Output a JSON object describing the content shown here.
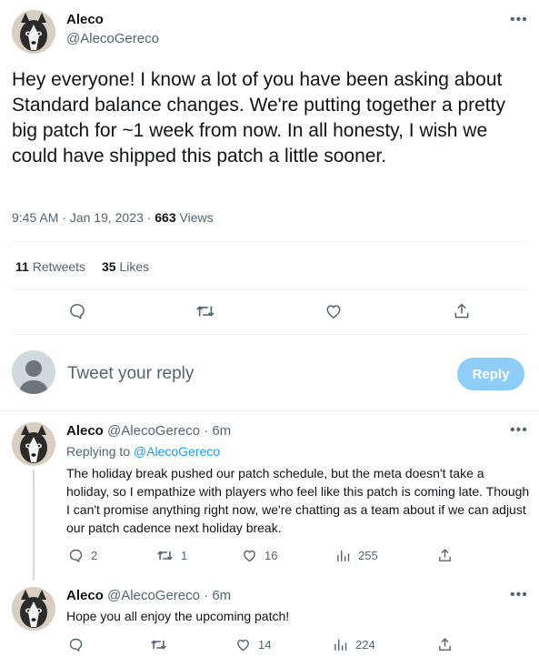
{
  "main_tweet": {
    "author_name": "Aleco",
    "author_handle": "@AlecoGereco",
    "text": "Hey everyone! I know a lot of you have been asking about Standard balance changes. We're putting together a pretty big patch for ~1 week from now. In all honesty, I wish we could have shipped this patch a little sooner.",
    "time": "9:45 AM",
    "date": "Jan 19, 2023",
    "views_count": "663",
    "views_label": "Views",
    "retweets_count": "11",
    "retweets_label": "Retweets",
    "likes_count": "35",
    "likes_label": "Likes"
  },
  "compose": {
    "placeholder": "Tweet your reply",
    "button_label": "Reply"
  },
  "replies": [
    {
      "author_name": "Aleco",
      "author_handle": "@AlecoGereco",
      "time": "6m",
      "replying_to_label": "Replying to",
      "replying_to_handle": "@AlecoGereco",
      "text": "The holiday break pushed our patch schedule, but the meta doesn't take a holiday, so I empathize with players who feel like this patch is coming late. Though I can't promise anything right now, we're chatting as a team about if we can adjust our patch cadence next holiday break.",
      "replies": "2",
      "retweets": "1",
      "likes": "16",
      "views": "255"
    },
    {
      "author_name": "Aleco",
      "author_handle": "@AlecoGereco",
      "time": "6m",
      "text": "Hope you all enjoy the upcoming patch!",
      "replies": "",
      "retweets": "",
      "likes": "14",
      "views": "224"
    }
  ],
  "separators": {
    "dot": "·"
  },
  "icons": [
    "more-icon",
    "reply-icon",
    "retweet-icon",
    "like-icon",
    "share-icon",
    "views-icon",
    "avatar-placeholder-icon"
  ],
  "colors": {
    "accent": "#1d9bf0",
    "reply_button_bg": "#8ecdf8",
    "text": "#0f1419",
    "muted": "#536471"
  }
}
